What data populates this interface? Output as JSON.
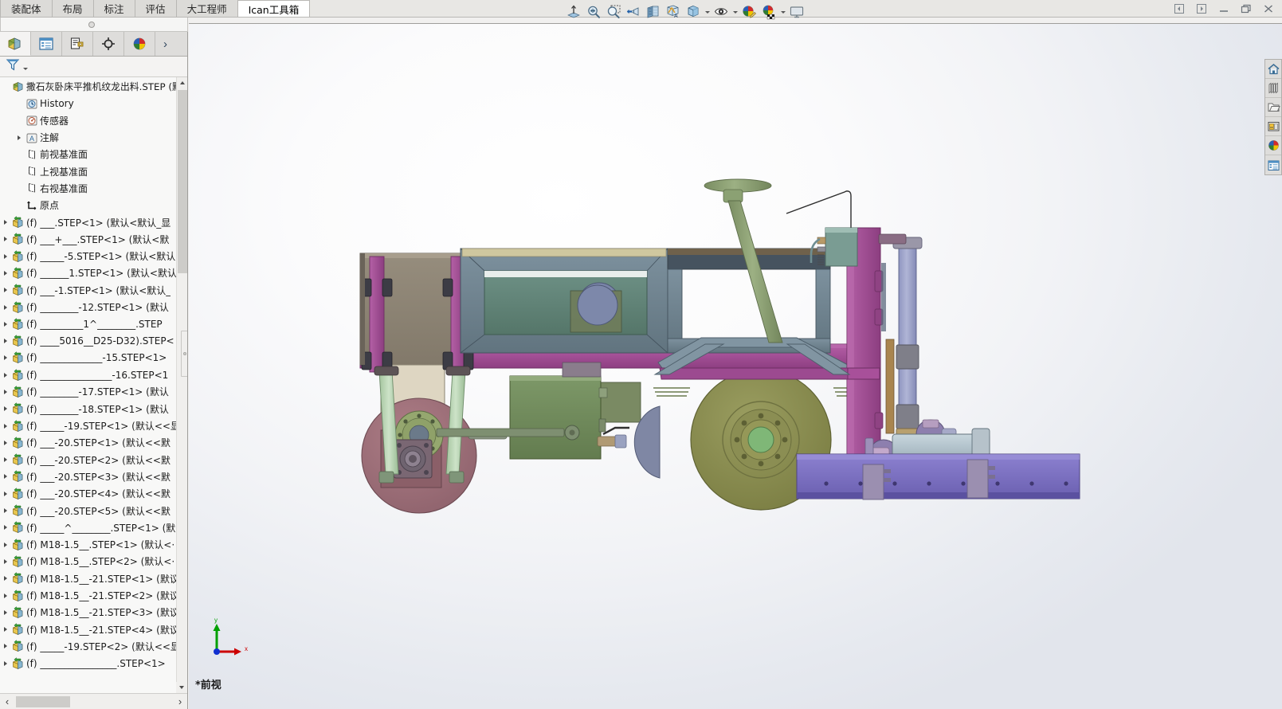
{
  "window": {
    "controls": [
      {
        "name": "prev-doc-button",
        "label": "◂"
      },
      {
        "name": "next-doc-button",
        "label": "▸"
      },
      {
        "name": "minimize-button",
        "label": "—"
      },
      {
        "name": "restore-button",
        "label": "❐"
      },
      {
        "name": "close-button",
        "label": "✕"
      }
    ]
  },
  "ribbon": {
    "tabs": [
      {
        "label": "装配体",
        "active": false
      },
      {
        "label": "布局",
        "active": false
      },
      {
        "label": "标注",
        "active": false
      },
      {
        "label": "评估",
        "active": false
      },
      {
        "label": "大工程师",
        "active": false
      },
      {
        "label": "Ican工具箱",
        "active": true
      }
    ]
  },
  "quick_toolbar": {
    "items": [
      {
        "name": "measure-icon",
        "caret": false
      },
      {
        "name": "zoom-to-fit-icon",
        "caret": false
      },
      {
        "name": "zoom-to-area-icon",
        "caret": false
      },
      {
        "name": "previous-view-icon",
        "caret": false
      },
      {
        "name": "section-view-icon",
        "caret": false
      },
      {
        "name": "view-orientation-icon",
        "caret": false
      },
      {
        "name": "display-style-icon",
        "caret": true
      },
      {
        "name": "hide-show-items-icon",
        "caret": true
      },
      {
        "name": "edit-appearance-icon",
        "caret": false
      },
      {
        "name": "apply-scene-icon",
        "caret": true
      },
      {
        "name": "view-settings-icon",
        "caret": false
      }
    ]
  },
  "feature_manager": {
    "tabs": [
      {
        "name": "feature-tree-tab",
        "icon": "assembly-tree-icon",
        "active": true
      },
      {
        "name": "property-manager-tab",
        "icon": "property-list-icon",
        "active": false
      },
      {
        "name": "configuration-manager-tab",
        "icon": "configuration-icon",
        "active": false
      },
      {
        "name": "dimxpert-manager-tab",
        "icon": "crosshair-icon",
        "active": false
      },
      {
        "name": "display-manager-tab",
        "icon": "appearance-sphere-icon",
        "active": false
      }
    ],
    "more_label": "›",
    "filter": {
      "name": "filter-icon",
      "placeholder": ""
    },
    "tree": [
      {
        "indent": 0,
        "arrow": false,
        "icon": "assembly-icon",
        "label": "撒石灰卧床平推机纹龙出料.STEP  (默"
      },
      {
        "indent": 1,
        "arrow": false,
        "icon": "history-icon",
        "label": "History"
      },
      {
        "indent": 1,
        "arrow": false,
        "icon": "sensor-icon",
        "label": "传感器"
      },
      {
        "indent": 1,
        "arrow": true,
        "icon": "annotation-icon",
        "label": "注解"
      },
      {
        "indent": 1,
        "arrow": false,
        "icon": "plane-icon",
        "label": "前视基准面"
      },
      {
        "indent": 1,
        "arrow": false,
        "icon": "plane-icon",
        "label": "上视基准面"
      },
      {
        "indent": 1,
        "arrow": false,
        "icon": "plane-icon",
        "label": "右视基准面"
      },
      {
        "indent": 1,
        "arrow": false,
        "icon": "origin-icon",
        "label": "原点"
      },
      {
        "indent": 0,
        "arrow": true,
        "icon": "component-icon",
        "label": "(f) ___.STEP<1>  (默认<默认_显"
      },
      {
        "indent": 0,
        "arrow": true,
        "icon": "component-icon",
        "label": "(f) ___+___.STEP<1>  (默认<默"
      },
      {
        "indent": 0,
        "arrow": true,
        "icon": "component-icon",
        "label": "(f) _____-5.STEP<1>  (默认<默认"
      },
      {
        "indent": 0,
        "arrow": true,
        "icon": "component-icon",
        "label": "(f) ______1.STEP<1>  (默认<默认"
      },
      {
        "indent": 0,
        "arrow": true,
        "icon": "component-icon",
        "label": "(f) ___-1.STEP<1>  (默认<默认_"
      },
      {
        "indent": 0,
        "arrow": true,
        "icon": "component-icon",
        "label": "(f) ________-12.STEP<1>  (默认"
      },
      {
        "indent": 0,
        "arrow": true,
        "icon": "component-icon",
        "label": "(f) _________1^________.STEP"
      },
      {
        "indent": 0,
        "arrow": true,
        "icon": "component-icon",
        "label": "(f) ____5016__D25-D32).STEP<"
      },
      {
        "indent": 0,
        "arrow": true,
        "icon": "component-icon",
        "label": "(f) _____________-15.STEP<1>"
      },
      {
        "indent": 0,
        "arrow": true,
        "icon": "component-icon",
        "label": "(f) _______________-16.STEP<1"
      },
      {
        "indent": 0,
        "arrow": true,
        "icon": "component-icon",
        "label": "(f) ________-17.STEP<1>  (默认"
      },
      {
        "indent": 0,
        "arrow": true,
        "icon": "component-icon",
        "label": "(f) ________-18.STEP<1>  (默认"
      },
      {
        "indent": 0,
        "arrow": true,
        "icon": "component-icon",
        "label": "(f) _____-19.STEP<1>  (默认<<显"
      },
      {
        "indent": 0,
        "arrow": true,
        "icon": "component-icon",
        "label": "(f) ___-20.STEP<1>  (默认<<默"
      },
      {
        "indent": 0,
        "arrow": true,
        "icon": "component-icon",
        "label": "(f) ___-20.STEP<2>  (默认<<默"
      },
      {
        "indent": 0,
        "arrow": true,
        "icon": "component-icon",
        "label": "(f) ___-20.STEP<3>  (默认<<默"
      },
      {
        "indent": 0,
        "arrow": true,
        "icon": "component-icon",
        "label": "(f) ___-20.STEP<4>  (默认<<默"
      },
      {
        "indent": 0,
        "arrow": true,
        "icon": "component-icon",
        "label": "(f) ___-20.STEP<5>  (默认<<默"
      },
      {
        "indent": 0,
        "arrow": true,
        "icon": "component-icon",
        "label": "(f) _____^________.STEP<1>  (默"
      },
      {
        "indent": 0,
        "arrow": true,
        "icon": "component-icon",
        "label": "(f) M18-1.5__.STEP<1>  (默认<·"
      },
      {
        "indent": 0,
        "arrow": true,
        "icon": "component-icon",
        "label": "(f) M18-1.5__.STEP<2>  (默认<·"
      },
      {
        "indent": 0,
        "arrow": true,
        "icon": "component-icon",
        "label": "(f) M18-1.5__-21.STEP<1>  (默议"
      },
      {
        "indent": 0,
        "arrow": true,
        "icon": "component-icon",
        "label": "(f) M18-1.5__-21.STEP<2>  (默议"
      },
      {
        "indent": 0,
        "arrow": true,
        "icon": "component-icon",
        "label": "(f) M18-1.5__-21.STEP<3>  (默议"
      },
      {
        "indent": 0,
        "arrow": true,
        "icon": "component-icon",
        "label": "(f) M18-1.5__-21.STEP<4>  (默议"
      },
      {
        "indent": 0,
        "arrow": true,
        "icon": "component-icon",
        "label": "(f) _____-19.STEP<2>  (默认<<显"
      },
      {
        "indent": 0,
        "arrow": true,
        "icon": "component-icon",
        "label": "(f) ________________.STEP<1>"
      }
    ],
    "hscroll": {
      "left_label": "‹",
      "right_label": "›"
    }
  },
  "graphics": {
    "view_label": "*前视",
    "triad": {
      "x_label": "x",
      "y_label": "y",
      "x_color": "#cc0000",
      "y_color": "#00a000",
      "origin_color": "#1030d0"
    },
    "background_top": "#ffffff",
    "background_bottom": "#e2e5ec"
  },
  "task_pane": {
    "items": [
      {
        "name": "solidworks-resources-icon",
        "label": "SOLIDWORKS 资源"
      },
      {
        "name": "design-library-icon",
        "label": "设计库"
      },
      {
        "name": "file-explorer-icon",
        "label": "文件探索器"
      },
      {
        "name": "view-palette-icon",
        "label": "视图调色板"
      },
      {
        "name": "appearances-scenes-icon",
        "label": "外观、场景和贴图"
      },
      {
        "name": "custom-properties-icon",
        "label": "自定义属性"
      }
    ]
  },
  "model_colors": {
    "frame_magenta": "#a8509a",
    "frame_magenta_dark": "#8e3f82",
    "blade_purple": "#7a6fc4",
    "blade_purple_dark": "#6257ad",
    "wheel_olive": "#8c8f54",
    "wheel_olive_dark": "#787b43",
    "wheel_maroon": "#a0707a",
    "hopper_taupe": "#8e8575",
    "hopper_cream": "#ded6c2",
    "box_slate": "#6f8390",
    "box_teal": "#5f8278",
    "green_box": "#6f8a5c",
    "handle_green": "#869a6e",
    "cylinder_blue": "#9aa0c8",
    "mint": "#b9d3b4"
  }
}
